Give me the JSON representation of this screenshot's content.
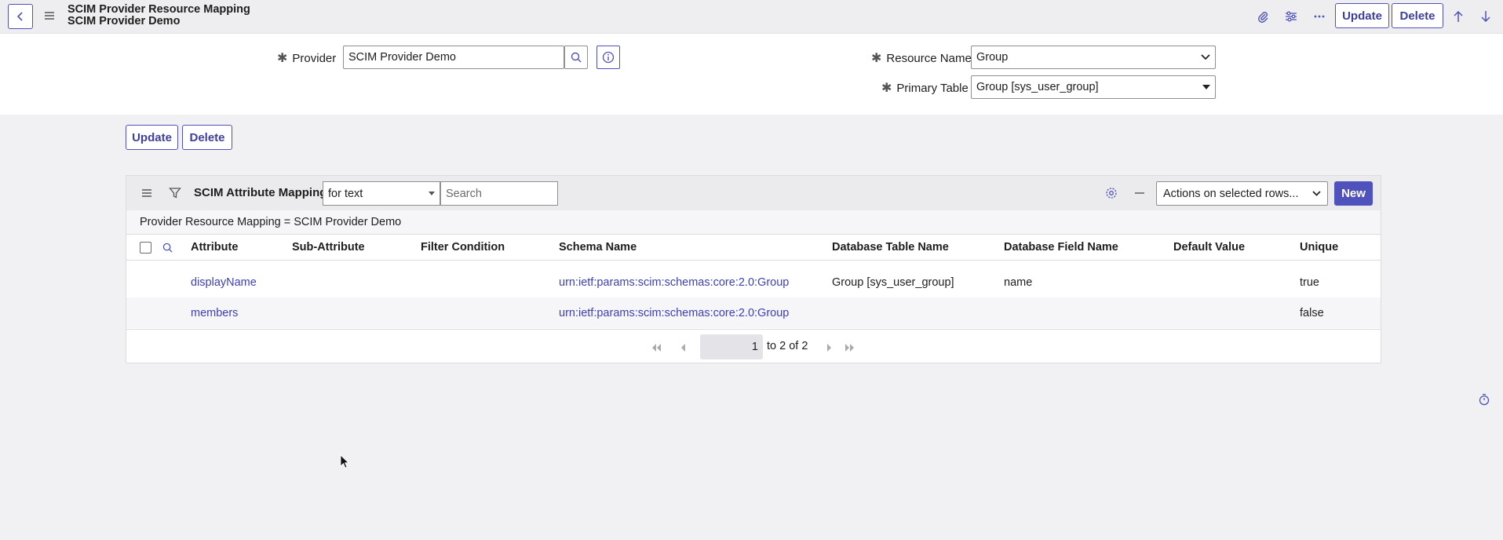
{
  "header": {
    "title_line1": "SCIM Provider Resource Mapping",
    "title_line2": "SCIM Provider Demo",
    "update_label": "Update",
    "delete_label": "Delete"
  },
  "form": {
    "provider_label": "Provider",
    "provider_value": "SCIM Provider Demo",
    "resource_name_label": "Resource Name",
    "resource_name_value": "Group",
    "primary_table_label": "Primary Table",
    "primary_table_value": "Group [sys_user_group]",
    "update_label": "Update",
    "delete_label": "Delete"
  },
  "related_list": {
    "title": "SCIM Attribute Mappings",
    "filter_field": "for text",
    "search_placeholder": "Search",
    "actions_label": "Actions on selected rows...",
    "new_label": "New",
    "breadcrumb": "Provider Resource Mapping = SCIM Provider Demo",
    "columns": [
      "Attribute",
      "Sub-Attribute",
      "Filter Condition",
      "Schema Name",
      "Database Table Name",
      "Database Field Name",
      "Default Value",
      "Unique"
    ],
    "rows": [
      {
        "attribute": "displayName",
        "sub_attribute": "",
        "filter_condition": "",
        "schema_name": "urn:ietf:params:scim:schemas:core:2.0:Group",
        "db_table": "Group [sys_user_group]",
        "db_field": "name",
        "default_value": "",
        "unique": "true"
      },
      {
        "attribute": "members",
        "sub_attribute": "",
        "filter_condition": "",
        "schema_name": "urn:ietf:params:scim:schemas:core:2.0:Group",
        "db_table": "",
        "db_field": "",
        "default_value": "",
        "unique": "false"
      }
    ],
    "pagination": {
      "page_value": "1",
      "range_text": "to 2 of 2"
    }
  },
  "colors": {
    "accent": "#4f52bd",
    "link": "#3d3fb8"
  }
}
